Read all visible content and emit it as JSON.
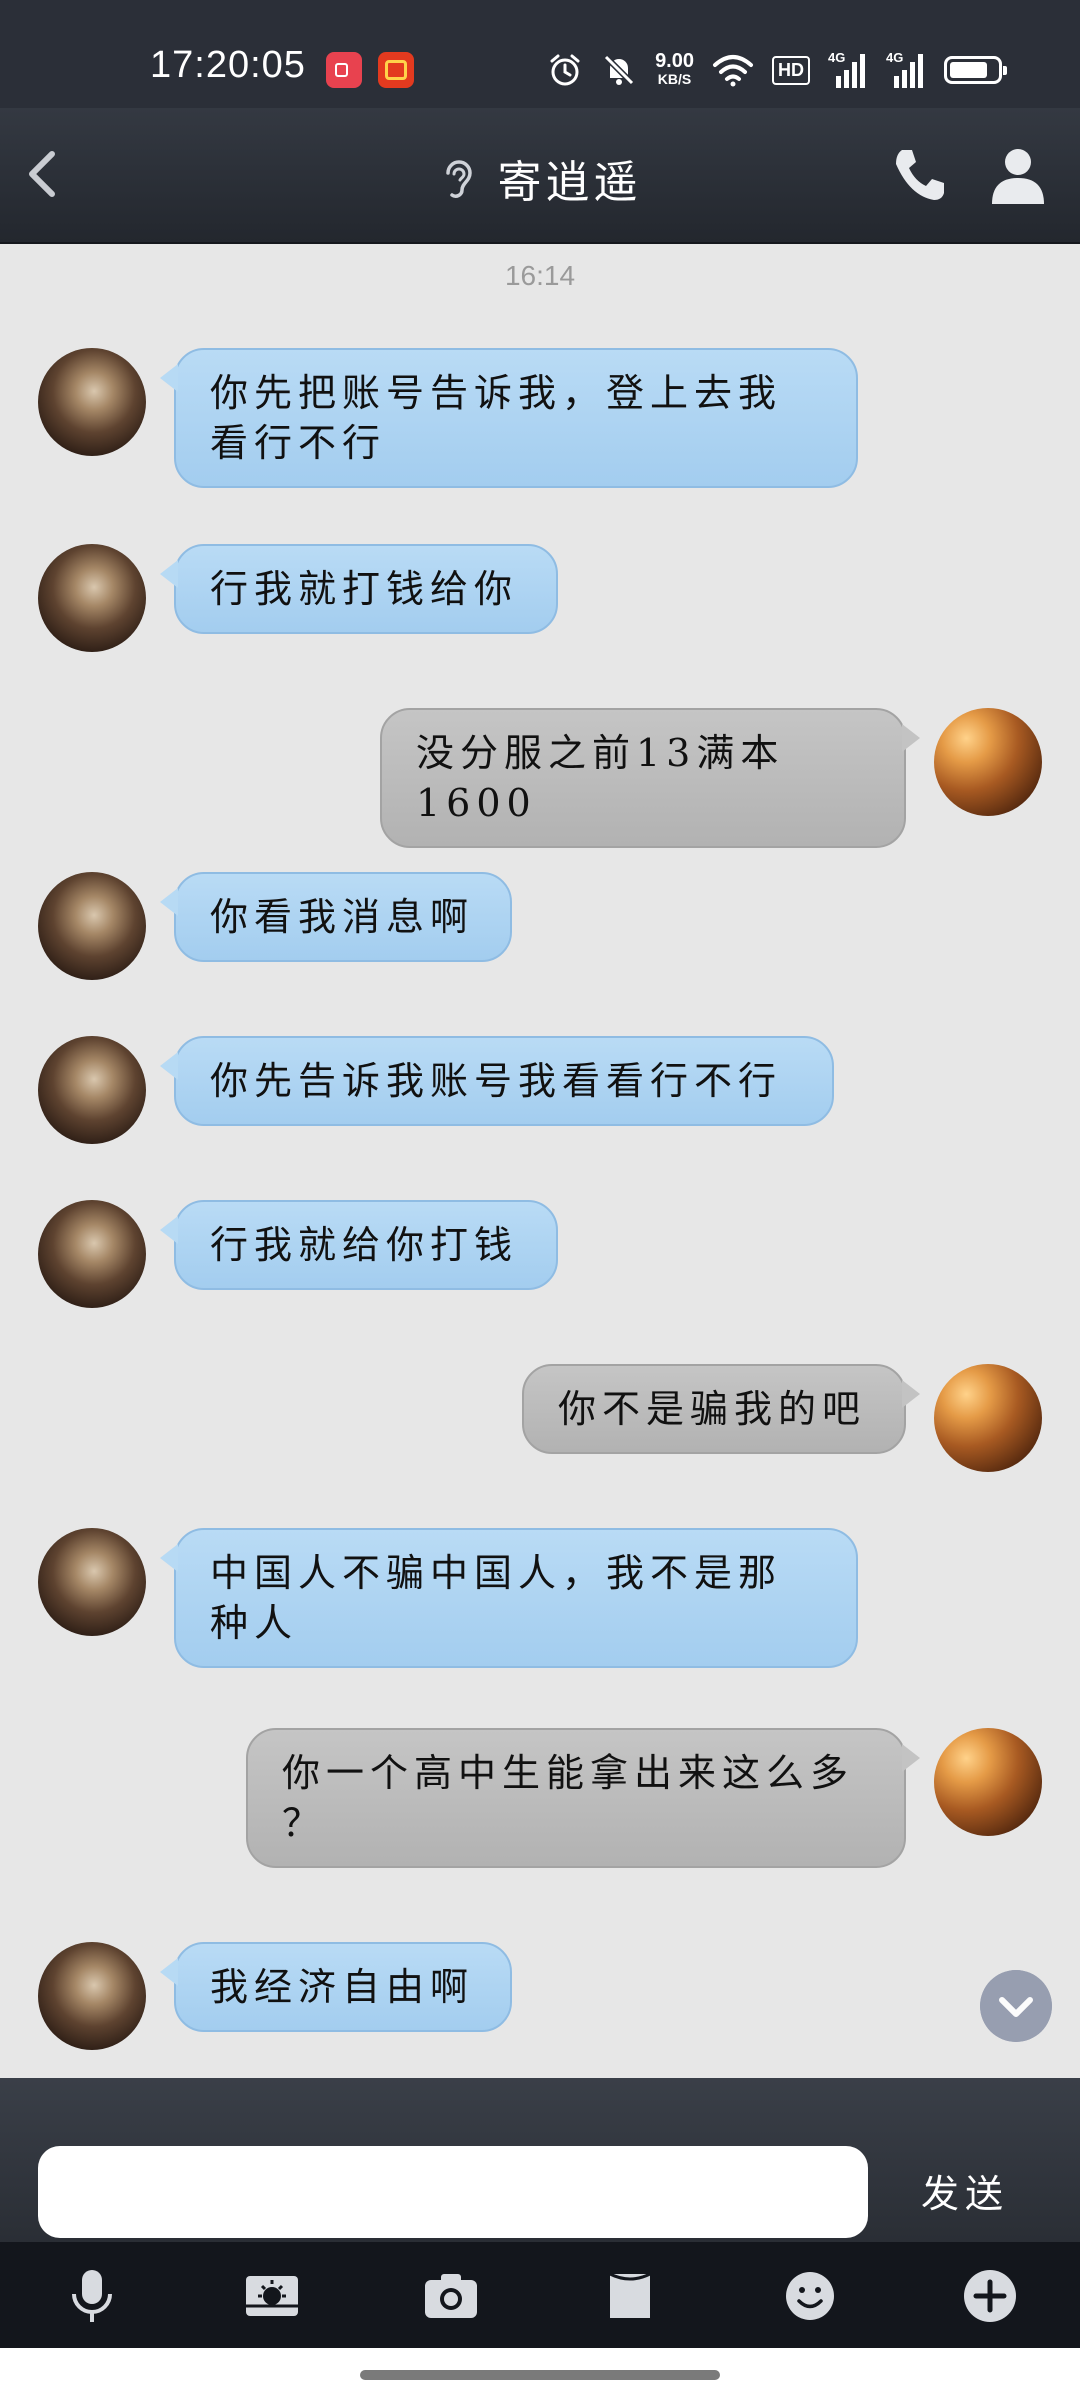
{
  "status_bar": {
    "time": "17:20:05",
    "net_speed_value": "9.00",
    "net_speed_unit": "KB/S",
    "hd_label": "HD",
    "net1_label": "4G",
    "net2_label": "4G",
    "battery_level": 0.8,
    "icons": [
      "screen-record-icon",
      "app-notification-icon",
      "alarm-icon",
      "mute-bell-icon",
      "wifi-icon",
      "hd-icon",
      "signal-4g-icon",
      "signal-4g-icon",
      "battery-icon"
    ]
  },
  "header": {
    "title": "寄逍遥",
    "icons": [
      "back-chevron-icon",
      "ear-icon",
      "phone-icon",
      "person-icon"
    ]
  },
  "chat": {
    "timestamp": "16:14",
    "messages": [
      {
        "sender": "them",
        "lines": [
          "你先把账号告诉我，登上去我",
          "看行不行"
        ]
      },
      {
        "sender": "them",
        "lines": [
          "行我就打钱给你"
        ]
      },
      {
        "sender": "me",
        "lines": [
          "没分服之前13满本1600"
        ]
      },
      {
        "sender": "them",
        "lines": [
          "你看我消息啊"
        ]
      },
      {
        "sender": "them",
        "lines": [
          "你先告诉我账号我看看行不行"
        ]
      },
      {
        "sender": "them",
        "lines": [
          "行我就给你打钱"
        ]
      },
      {
        "sender": "me",
        "lines": [
          "你不是骗我的吧"
        ]
      },
      {
        "sender": "them",
        "lines": [
          "中国人不骗中国人，我不是那",
          "种人"
        ]
      },
      {
        "sender": "me",
        "lines": [
          "你一个高中生能拿出来这么多",
          "？"
        ]
      },
      {
        "sender": "them",
        "lines": [
          "我经济自由啊"
        ]
      }
    ]
  },
  "input": {
    "value": "",
    "placeholder": "",
    "send_label": "发送"
  },
  "toolbar": {
    "tools": [
      "microphone-icon",
      "image-icon",
      "camera-icon",
      "file-icon",
      "emoji-icon",
      "plus-icon"
    ]
  },
  "colors": {
    "their_bubble": "#a9d0f0",
    "my_bubble": "#bdbdbd",
    "chat_bg": "#e7e7e7",
    "header_bg": "#2b2f38"
  }
}
